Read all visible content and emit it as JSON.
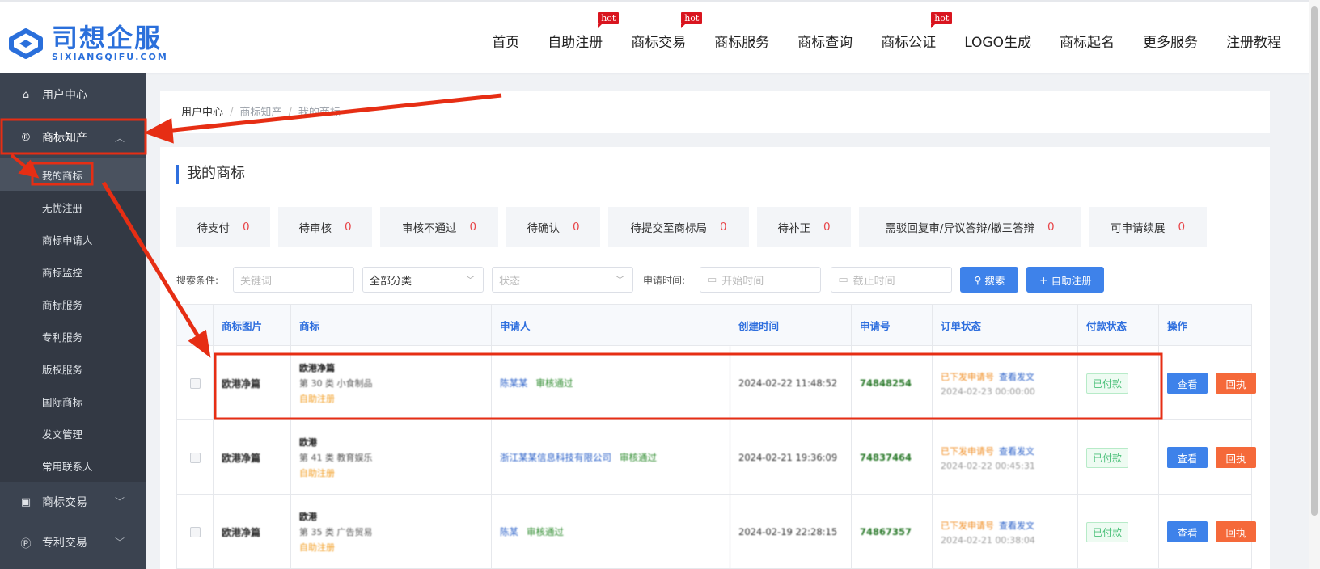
{
  "brand": {
    "name_cn": "司想企服",
    "name_en": "SIXIANGQIFU.COM"
  },
  "nav": [
    {
      "label": "首页",
      "hot": ""
    },
    {
      "label": "自助注册",
      "hot": "hot"
    },
    {
      "label": "商标交易",
      "hot": "hot"
    },
    {
      "label": "商标服务",
      "hot": ""
    },
    {
      "label": "商标查询",
      "hot": ""
    },
    {
      "label": "商标公证",
      "hot": "hot"
    },
    {
      "label": "LOGO生成",
      "hot": ""
    },
    {
      "label": "商标起名",
      "hot": ""
    },
    {
      "label": "更多服务",
      "hot": ""
    },
    {
      "label": "注册教程",
      "hot": ""
    }
  ],
  "sidebar": {
    "top": {
      "label": "用户中心",
      "icon": "home-icon"
    },
    "group": {
      "label": "商标知产",
      "icon": "registered-icon"
    },
    "sub_items": [
      "我的商标",
      "无忧注册",
      "商标申请人",
      "商标监控",
      "商标服务",
      "专利服务",
      "版权服务",
      "国际商标",
      "发文管理",
      "常用联系人"
    ],
    "bottom": [
      {
        "label": "商标交易",
        "icon": "cart-icon"
      },
      {
        "label": "专利交易",
        "icon": "patent-icon"
      }
    ]
  },
  "breadcrumb": [
    "用户中心",
    "商标知产",
    "我的商标"
  ],
  "page_title": "我的商标",
  "stats": [
    {
      "label": "待支付",
      "count": "0"
    },
    {
      "label": "待审核",
      "count": "0"
    },
    {
      "label": "审核不通过",
      "count": "0"
    },
    {
      "label": "待确认",
      "count": "0"
    },
    {
      "label": "待提交至商标局",
      "count": "0"
    },
    {
      "label": "待补正",
      "count": "0"
    },
    {
      "label": "需驳回复审/异议答辩/撤三答辩",
      "count": "0"
    },
    {
      "label": "可申请续展",
      "count": "0"
    }
  ],
  "filters": {
    "label": "搜索条件:",
    "keyword_placeholder": "关键词",
    "category": "全部分类",
    "status_placeholder": "状态",
    "time_label": "申请时间:",
    "start_placeholder": "开始时间",
    "dash": "-",
    "end_placeholder": "截止时间",
    "search_btn": "搜索",
    "register_btn": "自助注册"
  },
  "table": {
    "headers": [
      "",
      "商标图片",
      "商标",
      "申请人",
      "创建时间",
      "申请号",
      "订单状态",
      "付款状态",
      "操作"
    ],
    "rows": [
      {
        "pic": "欧港净篇",
        "name": "欧港净篇",
        "cls": "第 30 类   小食制品",
        "tag": "自助注册",
        "applicant": "陈某某",
        "applicant_tag": "审核通过",
        "created": "2024-02-22 11:48:52",
        "appno": "74848254",
        "status1": "已下发申请号",
        "status2": "查看发文",
        "status_time": "2024-02-23 00:00:00",
        "paid": "已付款",
        "view": "查看",
        "reply": "回执"
      },
      {
        "pic": "欧港净篇",
        "name": "欧港",
        "cls": "第 41 类   教育娱乐",
        "tag": "自助注册",
        "applicant": "浙江某某信息科技有限公司",
        "applicant_tag": "审核通过",
        "created": "2024-02-21 19:36:09",
        "appno": "74837464",
        "status1": "已下发申请号",
        "status2": "查看发文",
        "status_time": "2024-02-22 00:45:31",
        "paid": "已付款",
        "view": "查看",
        "reply": "回执"
      },
      {
        "pic": "欧港净篇",
        "name": "欧港",
        "cls": "第 35 类   广告贸易",
        "tag": "自助注册",
        "applicant": "陈某",
        "applicant_tag": "审核通过",
        "created": "2024-02-19 22:28:15",
        "appno": "74867357",
        "status1": "已下发申请号",
        "status2": "查看发文",
        "status_time": "2024-02-21 00:38:04",
        "paid": "已付款",
        "view": "查看",
        "reply": "回执"
      }
    ]
  },
  "colors": {
    "accent": "#2f6fde",
    "danger": "#e8464a",
    "annotation": "#e62e14",
    "sidebar": "#3b4350"
  }
}
